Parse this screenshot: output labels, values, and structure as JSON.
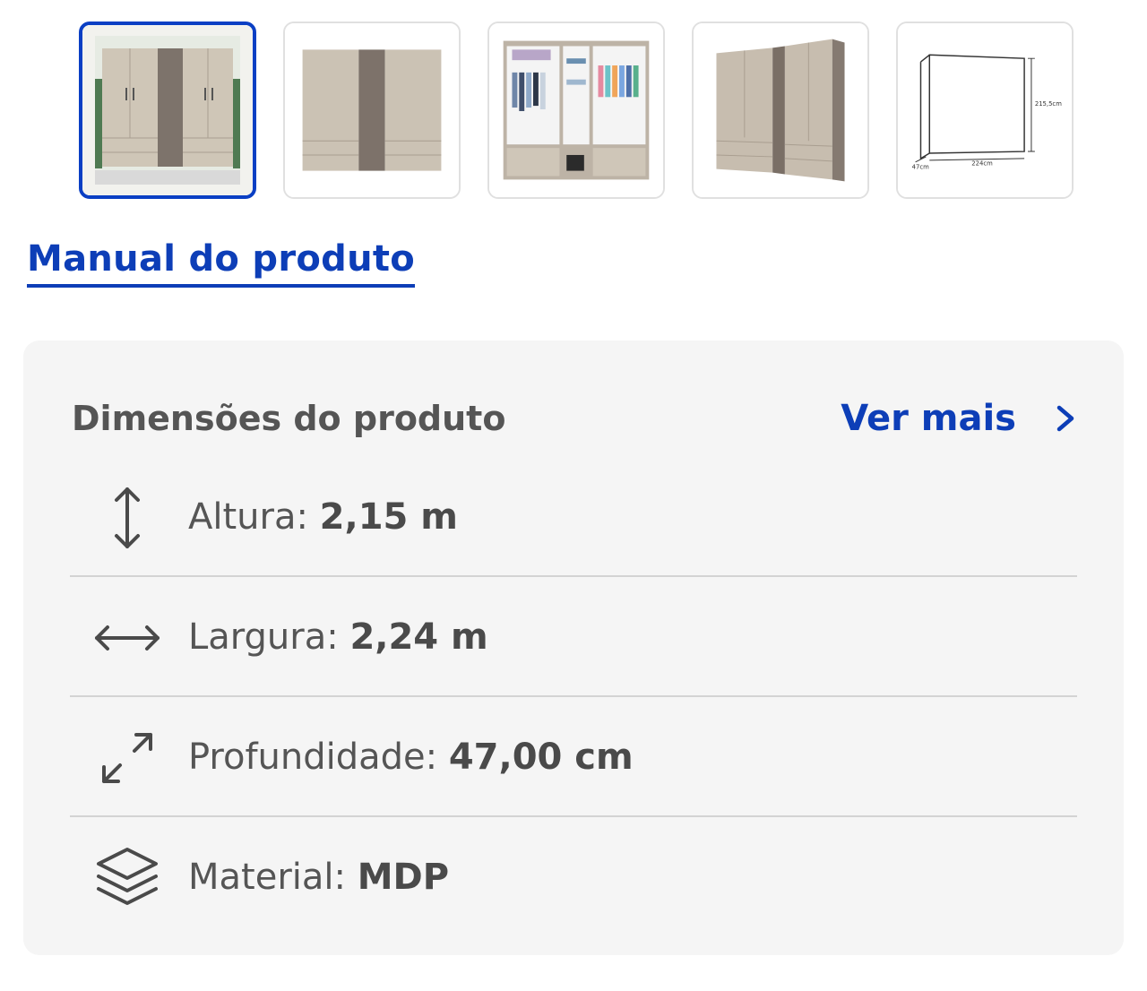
{
  "gallery": {
    "selected_index": 0,
    "thumbnails": [
      {
        "subject": "wardrobe-front-in-room"
      },
      {
        "subject": "wardrobe-front-closed"
      },
      {
        "subject": "wardrobe-open-interior"
      },
      {
        "subject": "wardrobe-angled-view"
      },
      {
        "subject": "wardrobe-dimension-diagram",
        "labels": [
          "215,5cm",
          "47cm",
          "224cm"
        ]
      }
    ]
  },
  "manual_link": "Manual do produto",
  "dimensions": {
    "title": "Dimensões do produto",
    "see_more": "Ver mais",
    "items": [
      {
        "icon": "vertical-arrow-icon",
        "label": "Altura:",
        "value": "2,15 m"
      },
      {
        "icon": "horizontal-arrow-icon",
        "label": "Largura:",
        "value": "2,24 m"
      },
      {
        "icon": "diagonal-expand-icon",
        "label": "Profundidade:",
        "value": "47,00 cm"
      },
      {
        "icon": "layers-icon",
        "label": "Material:",
        "value": "MDP"
      }
    ]
  },
  "colors": {
    "accent": "#0d3eb7",
    "card_background": "#f5f5f5",
    "text": "#555555",
    "divider": "#d3d3d3"
  }
}
